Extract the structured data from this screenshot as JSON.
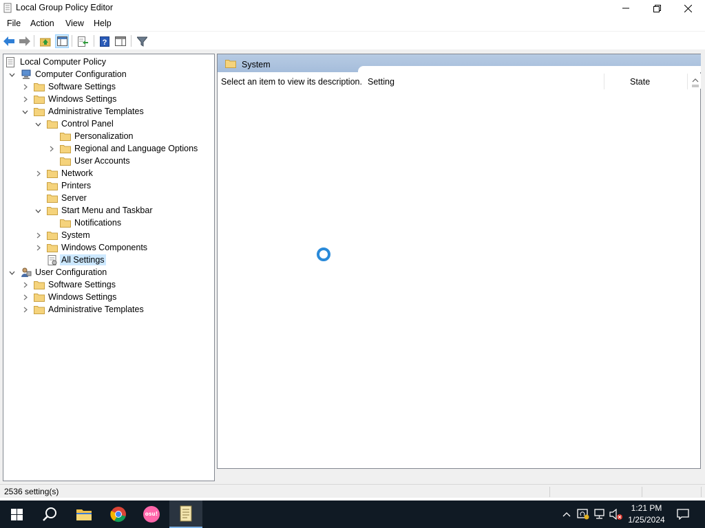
{
  "window": {
    "title": "Local Group Policy Editor"
  },
  "menu": [
    "File",
    "Action",
    "View",
    "Help"
  ],
  "tree": [
    {
      "label": "Local Computer Policy",
      "depth": 0,
      "icon": "policy-doc-icon",
      "expander": "none"
    },
    {
      "label": "Computer Configuration",
      "depth": 1,
      "icon": "computer-config-icon",
      "expander": "expanded"
    },
    {
      "label": "Software Settings",
      "depth": 2,
      "icon": "folder-icon",
      "expander": "collapsed"
    },
    {
      "label": "Windows Settings",
      "depth": 2,
      "icon": "folder-icon",
      "expander": "collapsed"
    },
    {
      "label": "Administrative Templates",
      "depth": 2,
      "icon": "folder-icon",
      "expander": "expanded"
    },
    {
      "label": "Control Panel",
      "depth": 3,
      "icon": "folder-icon",
      "expander": "expanded"
    },
    {
      "label": "Personalization",
      "depth": 4,
      "icon": "folder-icon",
      "expander": "none"
    },
    {
      "label": "Regional and Language Options",
      "depth": 4,
      "icon": "folder-icon",
      "expander": "collapsed"
    },
    {
      "label": "User Accounts",
      "depth": 4,
      "icon": "folder-icon",
      "expander": "none"
    },
    {
      "label": "Network",
      "depth": 3,
      "icon": "folder-icon",
      "expander": "collapsed"
    },
    {
      "label": "Printers",
      "depth": 3,
      "icon": "folder-icon",
      "expander": "none"
    },
    {
      "label": "Server",
      "depth": 3,
      "icon": "folder-icon",
      "expander": "none"
    },
    {
      "label": "Start Menu and Taskbar",
      "depth": 3,
      "icon": "folder-icon",
      "expander": "expanded"
    },
    {
      "label": "Notifications",
      "depth": 4,
      "icon": "folder-icon",
      "expander": "none"
    },
    {
      "label": "System",
      "depth": 3,
      "icon": "folder-icon",
      "expander": "collapsed"
    },
    {
      "label": "Windows Components",
      "depth": 3,
      "icon": "folder-icon",
      "expander": "collapsed"
    },
    {
      "label": "All Settings",
      "depth": 3,
      "icon": "all-settings-icon",
      "expander": "none",
      "selected": true
    },
    {
      "label": "User Configuration",
      "depth": 1,
      "icon": "user-config-icon",
      "expander": "expanded"
    },
    {
      "label": "Software Settings",
      "depth": 2,
      "icon": "folder-icon",
      "expander": "collapsed"
    },
    {
      "label": "Windows Settings",
      "depth": 2,
      "icon": "folder-icon",
      "expander": "collapsed"
    },
    {
      "label": "Administrative Templates",
      "depth": 2,
      "icon": "folder-icon",
      "expander": "collapsed"
    }
  ],
  "details": {
    "title": "System",
    "description": "Select an item to view its description.",
    "columns": [
      "Setting",
      "State"
    ]
  },
  "status": {
    "text": "2536 setting(s)"
  },
  "taskbar": {
    "time": "1:21 PM",
    "date": "1/25/2024",
    "pinned": [
      "start-icon",
      "search-icon",
      "file-explorer-icon",
      "chrome-icon",
      "osu-icon",
      "group-policy-editor-icon"
    ],
    "osu_label": "osu!"
  },
  "colors": {
    "selection": "#cce8ff",
    "header_band": "#a5bddb",
    "taskbar": "#101a24",
    "spinner": "#2a8ad9"
  }
}
